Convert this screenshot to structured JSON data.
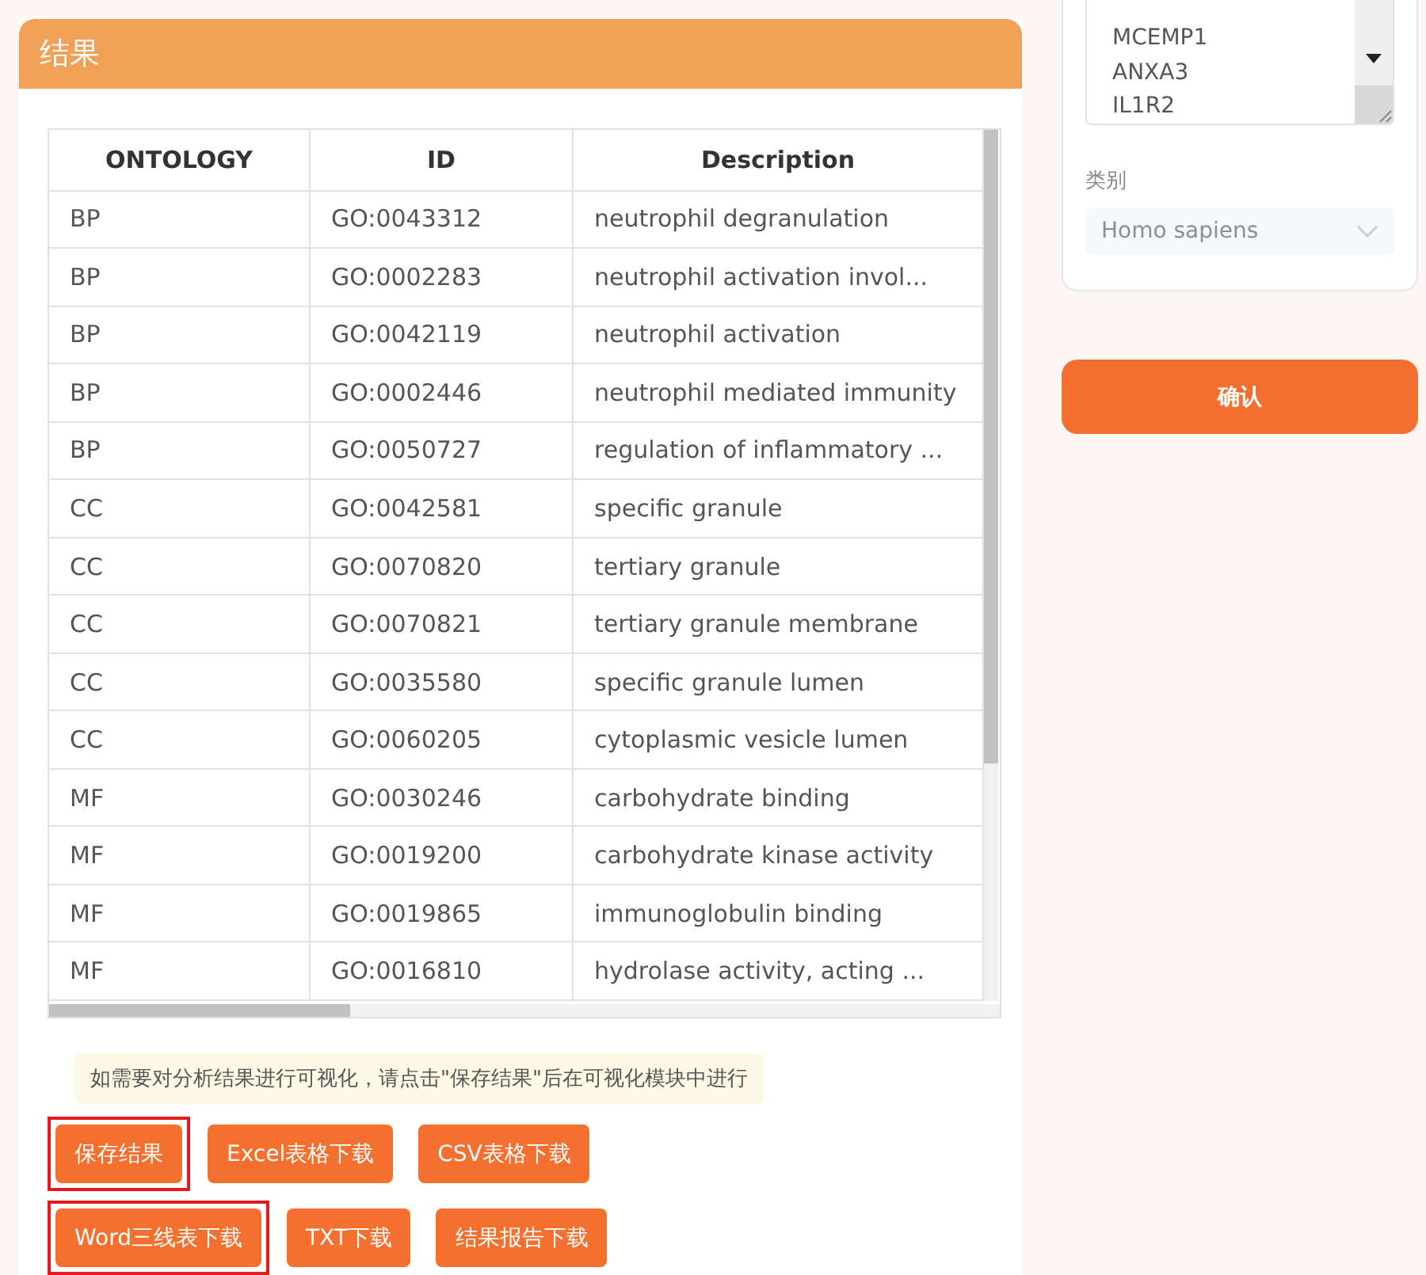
{
  "results_panel": {
    "title": "结果",
    "table": {
      "columns": [
        "ONTOLOGY",
        "ID",
        "Description"
      ],
      "rows": [
        [
          "BP",
          "GO:0043312",
          "neutrophil degranulation"
        ],
        [
          "BP",
          "GO:0002283",
          "neutrophil activation invol..."
        ],
        [
          "BP",
          "GO:0042119",
          "neutrophil activation"
        ],
        [
          "BP",
          "GO:0002446",
          "neutrophil mediated immunity"
        ],
        [
          "BP",
          "GO:0050727",
          "regulation of inflammatory ..."
        ],
        [
          "CC",
          "GO:0042581",
          "specific granule"
        ],
        [
          "CC",
          "GO:0070820",
          "tertiary granule"
        ],
        [
          "CC",
          "GO:0070821",
          "tertiary granule membrane"
        ],
        [
          "CC",
          "GO:0035580",
          "specific granule lumen"
        ],
        [
          "CC",
          "GO:0060205",
          "cytoplasmic vesicle lumen"
        ],
        [
          "MF",
          "GO:0030246",
          "carbohydrate binding"
        ],
        [
          "MF",
          "GO:0019200",
          "carbohydrate kinase activity"
        ],
        [
          "MF",
          "GO:0019865",
          "immunoglobulin binding"
        ],
        [
          "MF",
          "GO:0016810",
          "hydrolase activity, acting ..."
        ]
      ]
    },
    "tip": "如需要对分析结果进行可视化，请点击\"保存结果\"后在可视化模块中进行",
    "button_rows": [
      [
        {
          "label": "保存结果",
          "highlighted": true
        },
        {
          "label": "Excel表格下载",
          "highlighted": false
        },
        {
          "label": "CSV表格下载",
          "highlighted": false
        }
      ],
      [
        {
          "label": "Word三线表下载",
          "highlighted": true
        },
        {
          "label": "TXT下载",
          "highlighted": false
        },
        {
          "label": "结果报告下载",
          "highlighted": false
        }
      ]
    ]
  },
  "settings_panel": {
    "gene_list": [
      "MCEMP1",
      "ANXA3",
      "IL1R2"
    ],
    "species_label": "类别",
    "species_value": "Homo sapiens",
    "confirm_button": "确认"
  }
}
